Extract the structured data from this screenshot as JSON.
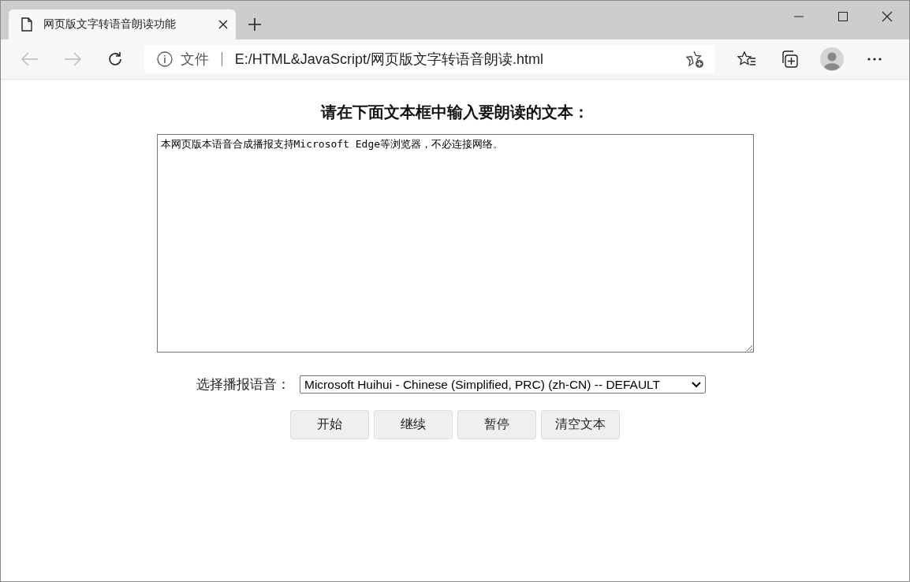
{
  "browser": {
    "tab": {
      "title": "网页版文字转语音朗读功能",
      "selected": true
    },
    "address_bar": {
      "security_label": "文件",
      "url": "E:/HTML&JavaScript/网页版文字转语音朗读.html"
    }
  },
  "page": {
    "heading": "请在下面文本框中输入要朗读的文本：",
    "text_area": {
      "value": "本网页版本语音合成播报支持Microsoft Edge等浏览器，不必连接网络。"
    },
    "voice": {
      "label": "选择播报语音：",
      "value": "Microsoft Huihui - Chinese (Simplified, PRC) (zh-CN) -- DEFAULT"
    },
    "buttons": [
      "开始",
      "继续",
      "暂停",
      "清空文本"
    ]
  }
}
